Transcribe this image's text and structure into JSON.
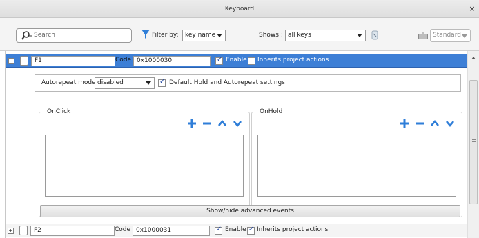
{
  "window": {
    "title": "Keyboard",
    "close_glyph": "×"
  },
  "toolbar": {
    "search_placeholder": "Search",
    "filter_label": "Filter by:",
    "filter_value": "key name",
    "shows_label": "Shows :",
    "shows_value": "all keys",
    "layout_value": "Standard"
  },
  "keys": [
    {
      "expander": "−",
      "name": "F1",
      "code_label": "Code",
      "code": "0x1000030",
      "enable_label": "Enable",
      "enable_checked": true,
      "inherit_label": "Inherits project actions",
      "inherit_checked": false,
      "selected": true
    },
    {
      "expander": "+",
      "name": "F2",
      "code_label": "Code",
      "code": "0x1000031",
      "enable_label": "Enable",
      "enable_checked": true,
      "inherit_label": "Inherits project actions",
      "inherit_checked": true,
      "selected": false
    }
  ],
  "detail": {
    "autorepeat_label": "Autorepeat mode",
    "autorepeat_value": "disabled",
    "default_hold_label": "Default Hold and Autorepeat settings",
    "default_hold_checked": true
  },
  "groups": {
    "onclick_title": "OnClick",
    "onhold_title": "OnHold"
  },
  "show_hide_label": "Show/hide advanced events",
  "icons": {
    "search": "search-icon",
    "filter": "funnel-icon",
    "add": "plus-icon",
    "remove": "minus-icon",
    "up": "chevron-up-icon",
    "down": "chevron-down-icon",
    "keyboard": "keyboard-icon"
  },
  "colors": {
    "accent": "#2f7ed8",
    "selection": "#3d7fd6"
  }
}
